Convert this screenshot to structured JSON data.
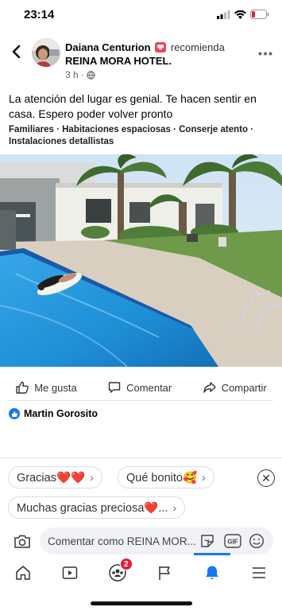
{
  "status": {
    "time": "23:14"
  },
  "post": {
    "author": "Daiana Centurion",
    "verb": "recomienda",
    "page": "REINA MORA HOTEL.",
    "time": "3 h ·",
    "text": "La atención del lugar es genial. Te hacen sentir en casa. Espero poder volver pronto",
    "tags": "Familiares · Habitaciones espaciosas · Conserje atento · Instalaciones detallistas"
  },
  "actions": {
    "like": "Me gusta",
    "comment": "Comentar",
    "share": "Compartir"
  },
  "reactions": {
    "names": "Martin Gorosito"
  },
  "quick_replies": [
    {
      "label": "Gracias❤️❤️"
    },
    {
      "label": "Qué bonito🥰"
    },
    {
      "label": "Muchas gracias preciosa❤️..."
    }
  ],
  "comment": {
    "placeholder": "Comentar como REINA MOR..."
  },
  "tabs": {
    "groups_badge": "2"
  },
  "colors": {
    "accent": "#1877f2",
    "badge": "#e41e3f",
    "pool": "#1e8fd6"
  }
}
